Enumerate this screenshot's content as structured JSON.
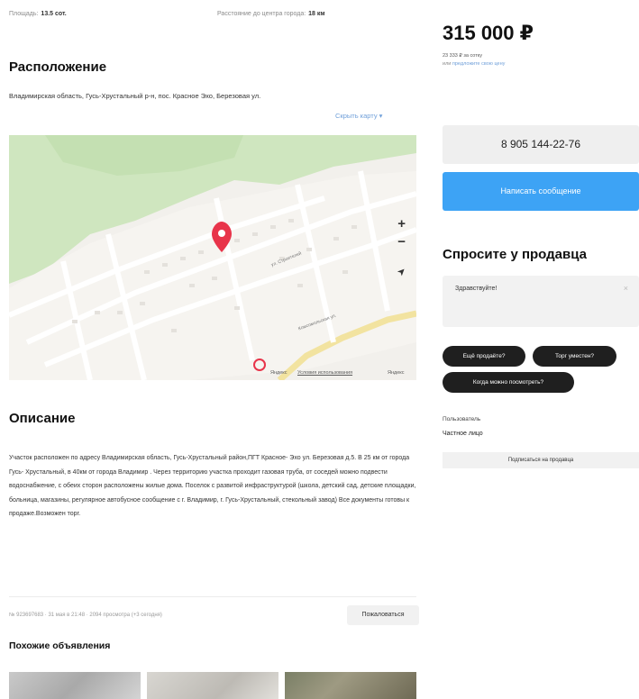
{
  "facts": {
    "area_label": "Площадь:",
    "area_value": "13.5 сот.",
    "distance_label": "Расстояние до центра города:",
    "distance_value": "18 км"
  },
  "location": {
    "title": "Расположение",
    "address": "Владимирская область, Гусь-Хрустальный р-н, пос. Красное Эхо, Березовая ул.",
    "hide_map": "Скрыть карту ▾",
    "zoom_in": "+",
    "zoom_out": "−",
    "locate": "➤",
    "street_label": "ул. Строителей",
    "street_label_2": "Комсомольская ул.",
    "attribution_yandex": "Яндекс",
    "terms_link": "Условия использования",
    "attribution_right": "Яндекс"
  },
  "description": {
    "title": "Описание",
    "text": "Участок расположен по адресу Владимирская область, Гусь-Хрустальный район,ПГТ Красное- Эхо ул. Березовая д.5. В 25 км от города Гусь- Хрустальный, в 40км от города Владимир . Через территорию участка проходит газовая труба, от соседей можно подвести водоснабжение, с обеих сторон расположены жилые дома. Поселок с развитой инфраструктурой (школа, детский сад, детские площадки, больница, магазины, регулярное автобусное сообщение с г. Владимир, г. Гусь-Хрустальный, стекольный завод) Все документы готовы к продаже.Возможен торг."
  },
  "meta": {
    "text": "№ 923697683 · 31 мая в 21:48 · 2094 просмотра (+3 сегодня)",
    "complain": "Пожаловаться"
  },
  "similar": {
    "title": "Похожие объявления"
  },
  "sidebar": {
    "price": "315 000 ₽",
    "price_per": "23 333 ₽ за сотку",
    "price_suggest_prefix": "или",
    "price_suggest_link": "предложите свою цену",
    "phone": "8 905 144-22-76",
    "write_message": "Написать сообщение",
    "ask_title": "Спросите у продавца",
    "ask_placeholder": "Здравствуйте!",
    "ask_clear": "×",
    "chips": [
      "Ещё продаёте?",
      "Торг уместен?",
      "Когда можно посмотреть?"
    ],
    "seller_role": "Пользователь",
    "seller_name": "Частное лицо",
    "subscribe": "Подписаться на продавца"
  },
  "colors": {
    "accent_blue": "#3da3f5",
    "link_blue": "#6f9fd9",
    "pin_red": "#e8344a"
  }
}
